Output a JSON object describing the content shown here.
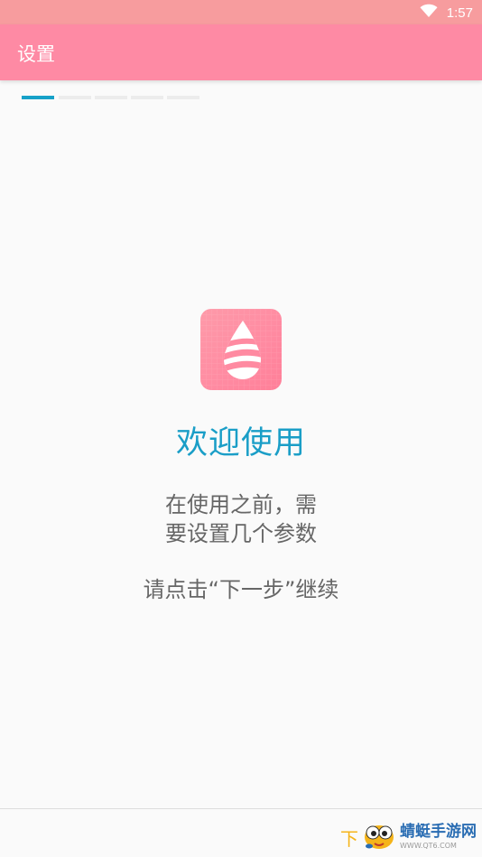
{
  "status_bar": {
    "time": "1:57",
    "background": "#f79c9e",
    "icons": [
      "wifi-icon"
    ]
  },
  "app_bar": {
    "title": "设置",
    "background": "#fe8aa4"
  },
  "progress": {
    "total_steps": 5,
    "current_step": 1,
    "active_color": "#16a1c8",
    "inactive_color": "#ececec"
  },
  "app_icon": {
    "icon": "water-drop-icon",
    "background": "#ff8aa1"
  },
  "welcome": {
    "title": "欢迎使用",
    "title_color": "#1a9ec7",
    "line1": "在使用之前，需",
    "line2": "要设置几个参数",
    "line3": "请点击“下一步”继续"
  },
  "watermark": {
    "prefix": "下",
    "name": "蜻蜓手游网",
    "url": "WWW.QT6.COM"
  }
}
